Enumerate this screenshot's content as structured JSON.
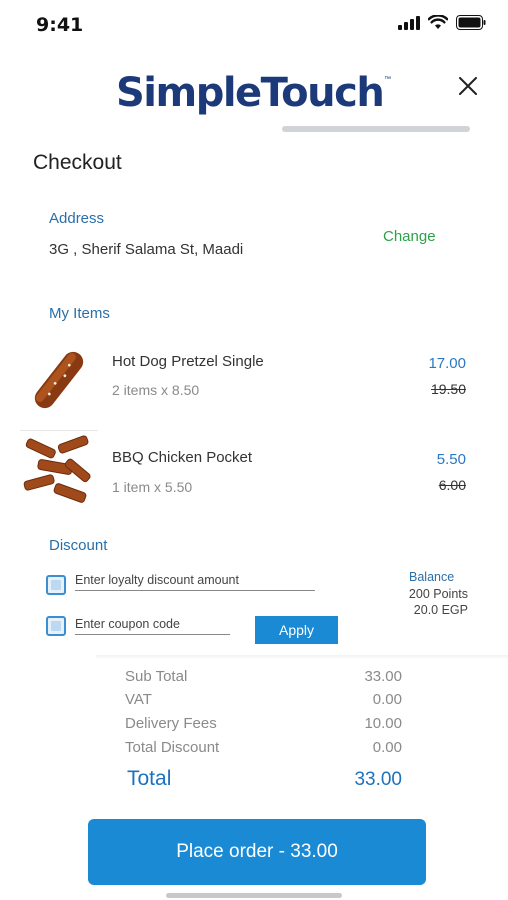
{
  "status_bar": {
    "time": "9:41",
    "icons": [
      "signal-icon",
      "wifi-icon",
      "battery-icon"
    ]
  },
  "header": {
    "logo": "SimpleTouch",
    "logo_tm": "™",
    "close_icon": "close-icon"
  },
  "page_title": "Checkout",
  "address": {
    "label": "Address",
    "value": "3G , Sherif Salama St, Maadi",
    "change_label": "Change"
  },
  "items_section": {
    "label": "My Items",
    "items": [
      {
        "name": "Hot Dog Pretzel Single",
        "qty": "2 items x 8.50",
        "price": "17.00",
        "old_price": "19.50",
        "image": "hot-dog-pretzel-image"
      },
      {
        "name": "BBQ Chicken Pocket",
        "qty": "1 item x 5.50",
        "price": "5.50",
        "old_price": "6.00",
        "image": "bbq-chicken-pocket-image"
      }
    ]
  },
  "discount": {
    "label": "Discount",
    "loyalty_placeholder": "Enter loyalty discount amount",
    "coupon_placeholder": "Enter coupon code",
    "apply_label": "Apply",
    "balance_label": "Balance",
    "balance_points": "200 Points",
    "balance_egp": "20.0 EGP"
  },
  "summary": {
    "rows": [
      {
        "label": "Sub Total",
        "value": "33.00"
      },
      {
        "label": "VAT",
        "value": "0.00"
      },
      {
        "label": "Delivery Fees",
        "value": "10.00"
      },
      {
        "label": "Total Discount",
        "value": "0.00"
      }
    ],
    "total_label": "Total",
    "total_value": "33.00"
  },
  "place_order_label": "Place order - 33.00",
  "colors": {
    "brand": "#1c3a7a",
    "accent": "#1a8ad4",
    "change": "#2fa04a"
  }
}
